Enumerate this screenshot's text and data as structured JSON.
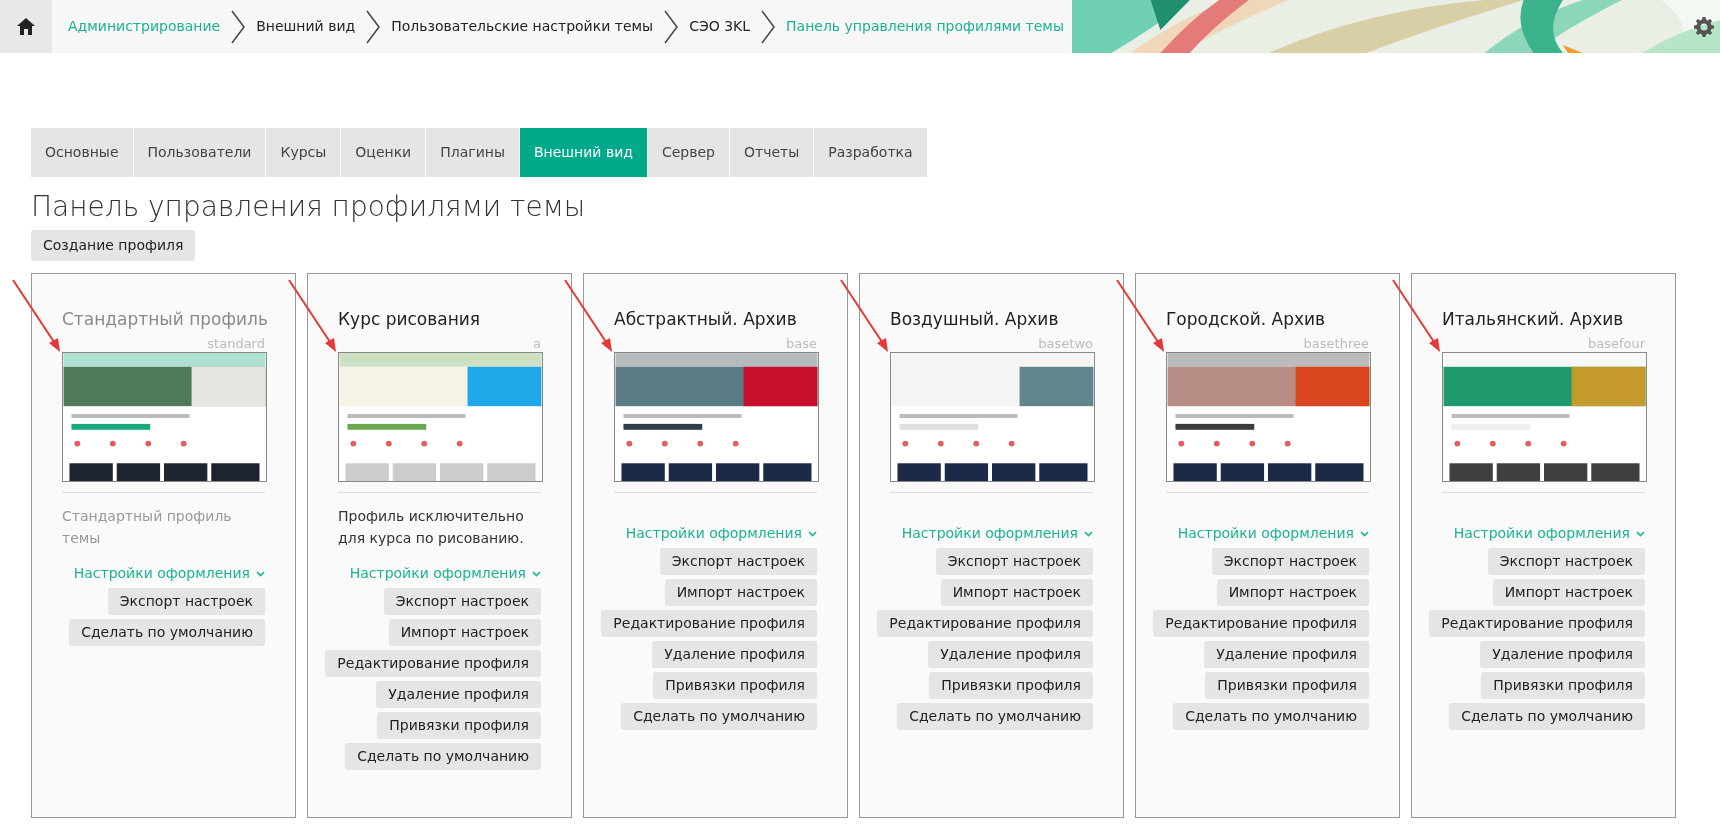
{
  "breadcrumbs": [
    {
      "label": "Администрирование",
      "link": true
    },
    {
      "label": "Внешний вид",
      "link": false
    },
    {
      "label": "Пользовательские настройки темы",
      "link": false
    },
    {
      "label": "СЭО 3KL",
      "link": false
    },
    {
      "label": "Панель управления профилями темы",
      "link": true
    }
  ],
  "tabs": [
    {
      "label": "Основные",
      "selected": false
    },
    {
      "label": "Пользователи",
      "selected": false
    },
    {
      "label": "Курсы",
      "selected": false
    },
    {
      "label": "Оценки",
      "selected": false
    },
    {
      "label": "Плагины",
      "selected": false
    },
    {
      "label": "Внешний вид",
      "selected": true
    },
    {
      "label": "Сервер",
      "selected": false
    },
    {
      "label": "Отчеты",
      "selected": false
    },
    {
      "label": "Разработка",
      "selected": false
    }
  ],
  "page_title": "Панель управления профилями темы",
  "create_button": "Создание профиля",
  "profiles": [
    {
      "title": "Стандартный профиль",
      "code": "standard",
      "muted": true,
      "arrow": true,
      "description": "Стандартный профиль темы",
      "settings_link": "Настройки оформления",
      "buttons": [
        "Экспорт настроек",
        "Сделать по умолчанию"
      ]
    },
    {
      "title": "Курс рисования",
      "code": "a",
      "muted": false,
      "arrow": true,
      "description": "Профиль исключительно для курса по рисованию.",
      "settings_link": "Настройки оформления",
      "buttons": [
        "Экспорт настроек",
        "Импорт настроек",
        "Редактирование профиля",
        "Удаление профиля",
        "Привязки профиля",
        "Сделать по умолчанию"
      ]
    },
    {
      "title": "Абстрактный. Архив",
      "code": "base",
      "muted": false,
      "arrow": true,
      "settings_link": "Настройки оформления",
      "buttons": [
        "Экспорт настроек",
        "Импорт настроек",
        "Редактирование профиля",
        "Удаление профиля",
        "Привязки профиля",
        "Сделать по умолчанию"
      ]
    },
    {
      "title": "Воздушный. Архив",
      "code": "basetwo",
      "muted": false,
      "arrow": true,
      "settings_link": "Настройки оформления",
      "buttons": [
        "Экспорт настроек",
        "Импорт настроек",
        "Редактирование профиля",
        "Удаление профиля",
        "Привязки профиля",
        "Сделать по умолчанию"
      ]
    },
    {
      "title": "Городской. Архив",
      "code": "basethree",
      "muted": false,
      "arrow": true,
      "settings_link": "Настройки оформления",
      "buttons": [
        "Экспорт настроек",
        "Импорт настроек",
        "Редактирование профиля",
        "Удаление профиля",
        "Привязки профиля",
        "Сделать по умолчанию"
      ]
    },
    {
      "title": "Итальянский. Архив",
      "code": "basefour",
      "muted": false,
      "arrow": true,
      "settings_link": "Настройки оформления",
      "buttons": [
        "Экспорт настроек",
        "Импорт настроек",
        "Редактирование профиля",
        "Удаление профиля",
        "Привязки профиля",
        "Сделать по умолчанию"
      ]
    }
  ]
}
